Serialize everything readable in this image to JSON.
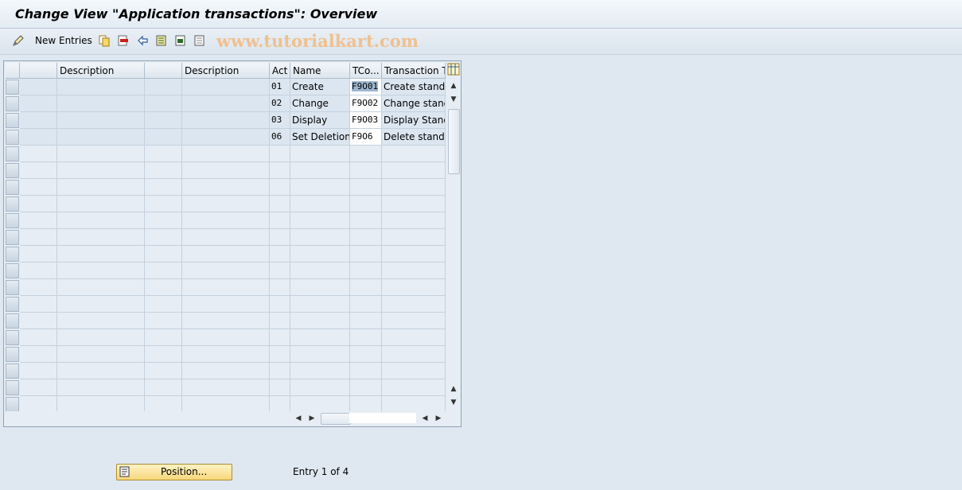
{
  "window": {
    "title": "Change View \"Application transactions\": Overview"
  },
  "toolbar": {
    "new_entries_label": "New Entries",
    "watermark": "www.tutorialkart.com",
    "icons": [
      "edit-icon",
      "copy-icon",
      "delete-icon",
      "undo-icon",
      "select-all-icon",
      "select-block-icon",
      "deselect-all-icon"
    ]
  },
  "table": {
    "columns": [
      "",
      "Description",
      "",
      "Description",
      "Act",
      "Name",
      "TCo...",
      "Transaction Te"
    ],
    "rows": [
      {
        "activity": "01",
        "name": "Create",
        "tcode": "F9O01",
        "transaction_text": "Create stand."
      },
      {
        "activity": "02",
        "name": "Change",
        "tcode": "F9O02",
        "transaction_text": "Change stand."
      },
      {
        "activity": "03",
        "name": "Display",
        "tcode": "F9O03",
        "transaction_text": "Display Standin"
      },
      {
        "activity": "06",
        "name": "Set Deletion...",
        "tcode": "F9O6",
        "transaction_text": "Delete stand."
      }
    ],
    "empty_row_count": 16
  },
  "footer": {
    "position_label": "Position...",
    "entry_status": "Entry 1 of 4"
  },
  "colors": {
    "background": "#dfe8f1",
    "button_gold": "#f6d77a",
    "selection": "#9fb7d1"
  }
}
